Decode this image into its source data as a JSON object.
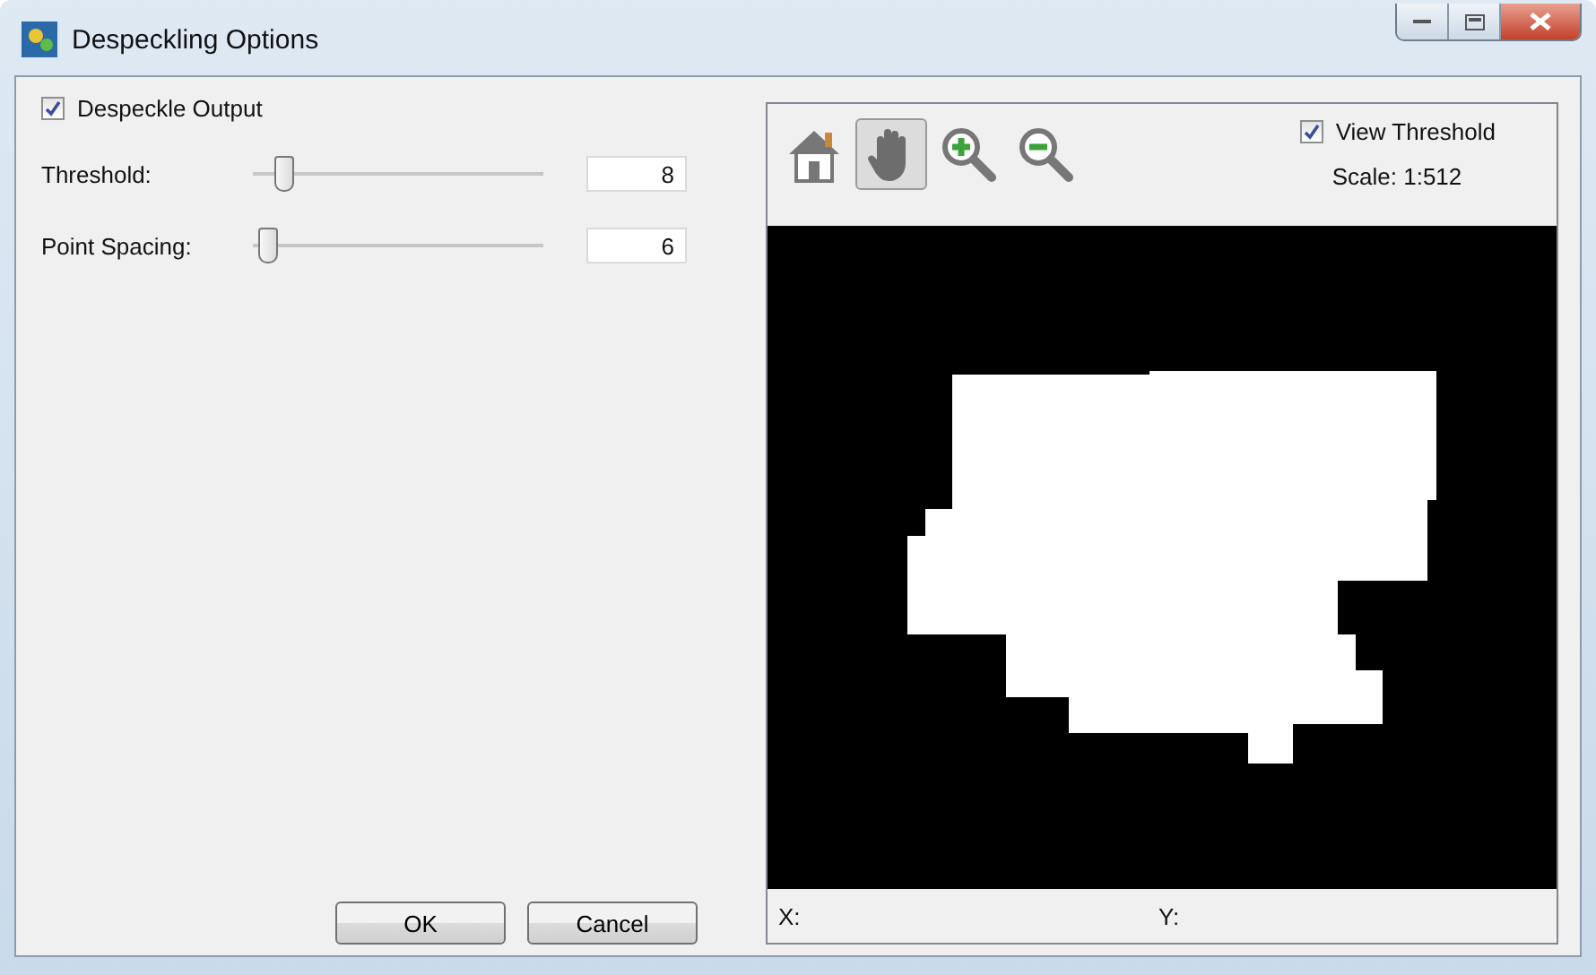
{
  "window": {
    "title": "Despeckling Options"
  },
  "despeckle_output": {
    "label": "Despeckle Output",
    "checked": true
  },
  "sliders": [
    {
      "label": "Threshold:",
      "level": 0.08,
      "value": "8"
    },
    {
      "label": "Point Spacing:",
      "level": 0.02,
      "value": "6"
    }
  ],
  "buttons": [
    "OK",
    "Cancel"
  ],
  "preview": {
    "tools": [
      {
        "kind": "home",
        "selected": false
      },
      {
        "kind": "pan",
        "selected": true
      },
      {
        "kind": "zoom-in",
        "selected": false
      },
      {
        "kind": "zoom-out",
        "selected": false
      }
    ],
    "view_threshold": {
      "label": "View Threshold",
      "checked": true
    },
    "scale": "Scale: 1:512",
    "x_label": "X:",
    "y_label": "Y:"
  }
}
